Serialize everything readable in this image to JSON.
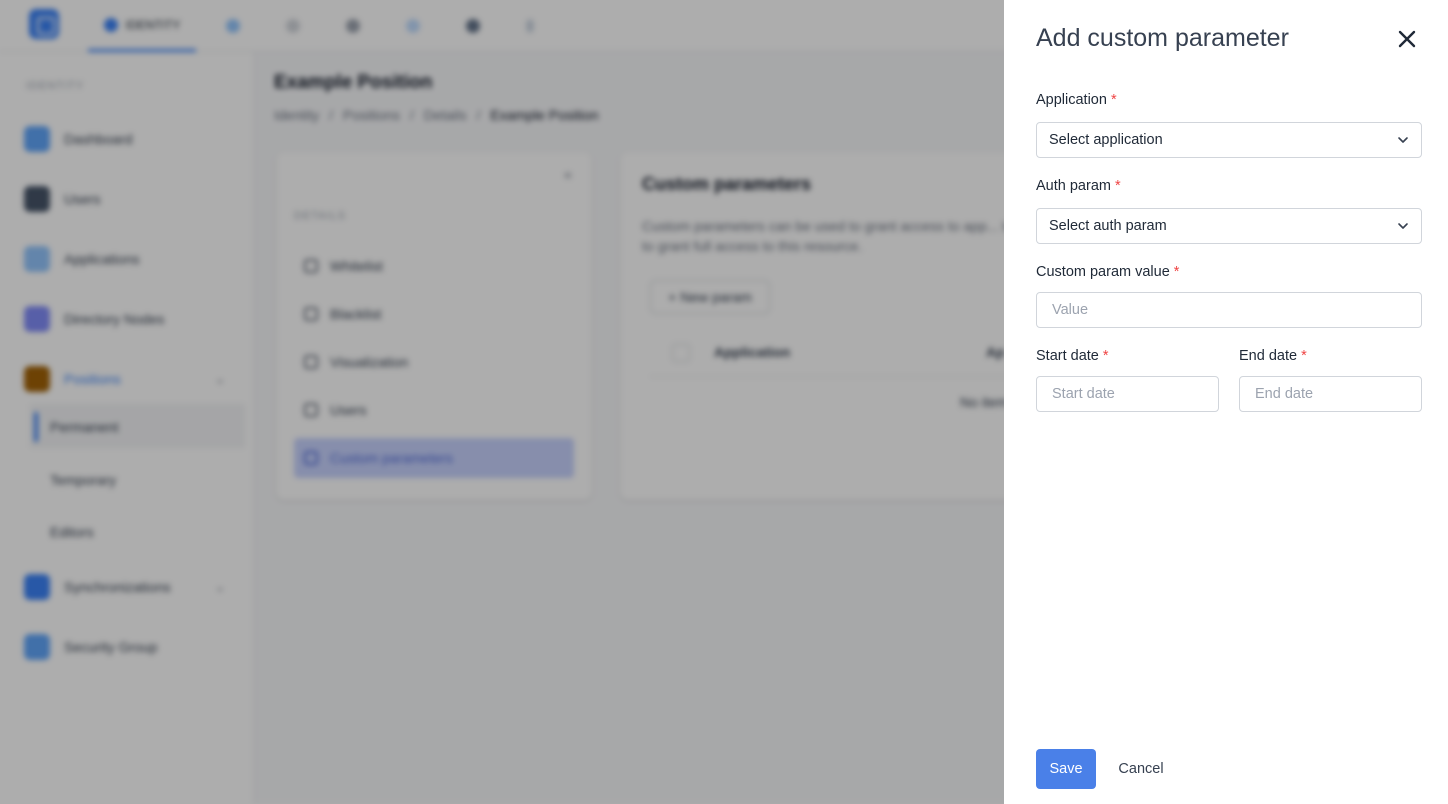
{
  "background": {
    "top_tabs": [
      "IDENTITY"
    ],
    "sidebar": {
      "section": "IDENTITY",
      "items": [
        "Dashboard",
        "Users",
        "Applications",
        "Directory Nodes",
        "Positions",
        "Synchronizations",
        "Security Group"
      ],
      "sub_items": [
        "Permanent",
        "Temporary",
        "Editors"
      ]
    },
    "page_title": "Example Position",
    "breadcrumb": [
      "Identity",
      "Positions",
      "Details",
      "Example Position"
    ],
    "left_card": {
      "section": "DETAILS",
      "items": [
        "Whitelist",
        "Blacklist",
        "Visualization",
        "Users",
        "Custom parameters"
      ]
    },
    "right_card": {
      "title": "Custom parameters",
      "description": "Custom parameters can be used to grant access to app... tab to grant full access to this resource.",
      "new_button": "+ New param",
      "columns": [
        "Application",
        "Ap"
      ],
      "empty": "No item"
    }
  },
  "drawer": {
    "title": "Add custom parameter",
    "required_mark": "*",
    "application": {
      "label": "Application",
      "placeholder": "Select application"
    },
    "auth_param": {
      "label": "Auth param",
      "placeholder": "Select auth param"
    },
    "custom_param_value": {
      "label": "Custom param value",
      "placeholder": "Value"
    },
    "start_date": {
      "label": "Start date",
      "placeholder": "Start date"
    },
    "end_date": {
      "label": "End date",
      "placeholder": "End date"
    },
    "save_label": "Save",
    "cancel_label": "Cancel"
  },
  "colors": {
    "accent": "#4a80e8",
    "required": "#ef4444",
    "overlay": "rgba(0,0,0,0.32)"
  }
}
